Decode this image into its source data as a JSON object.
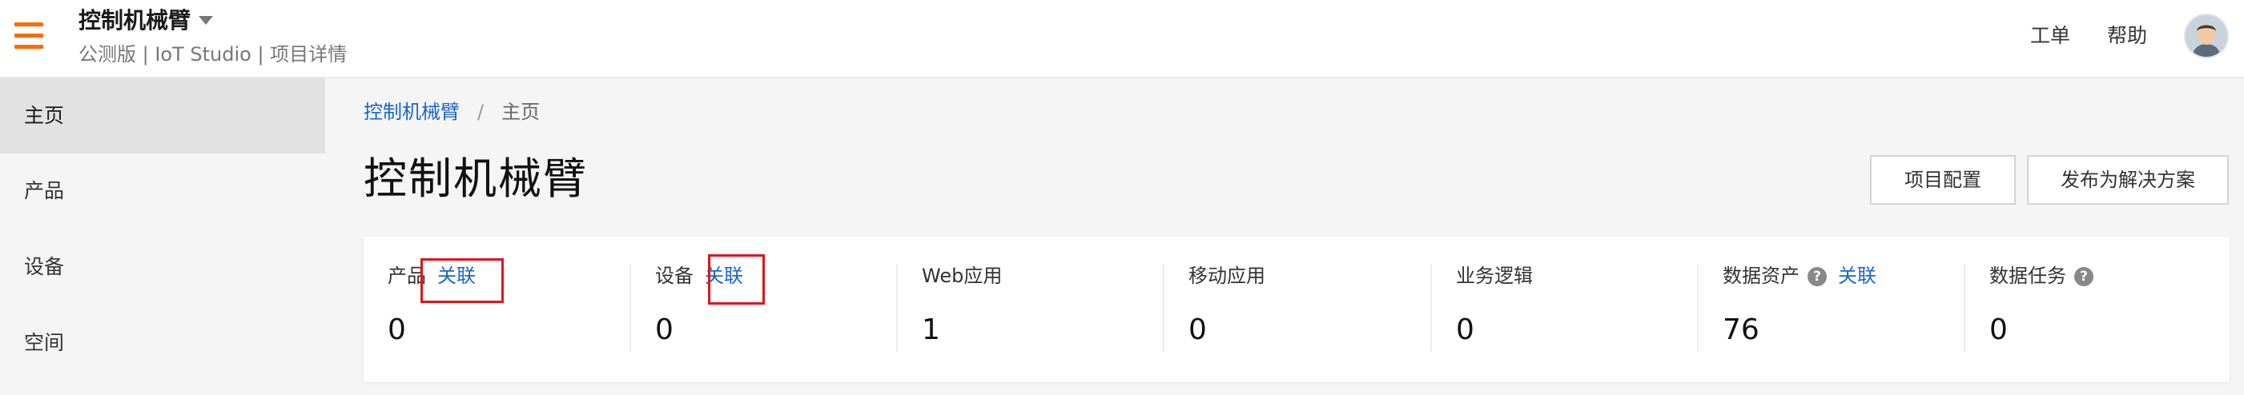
{
  "header": {
    "project_title": "控制机械臂",
    "subtitle": "公测版 | IoT Studio | 项目详情",
    "links": {
      "ticket": "工单",
      "help": "帮助"
    },
    "accent": "#ff6a00"
  },
  "sidebar": {
    "items": [
      {
        "label": "主页",
        "active": true
      },
      {
        "label": "产品"
      },
      {
        "label": "设备"
      },
      {
        "label": "空间"
      }
    ]
  },
  "breadcrumb": {
    "link": "控制机械臂",
    "separator": "/",
    "current": "主页"
  },
  "page": {
    "title": "控制机械臂"
  },
  "actions": {
    "config": "项目配置",
    "publish": "发布为解决方案"
  },
  "stats": [
    {
      "label": "产品",
      "link": "关联",
      "value": "0"
    },
    {
      "label": "设备",
      "link": "关联",
      "value": "0"
    },
    {
      "label": "Web应用",
      "value": "1"
    },
    {
      "label": "移动应用",
      "value": "0"
    },
    {
      "label": "业务逻辑",
      "value": "0"
    },
    {
      "label": "数据资产",
      "help": "?",
      "link": "关联",
      "value": "76"
    },
    {
      "label": "数据任务",
      "help": "?",
      "value": "0"
    }
  ],
  "colors": {
    "link": "#1a66c8",
    "highlight_box": "#e0141b"
  }
}
